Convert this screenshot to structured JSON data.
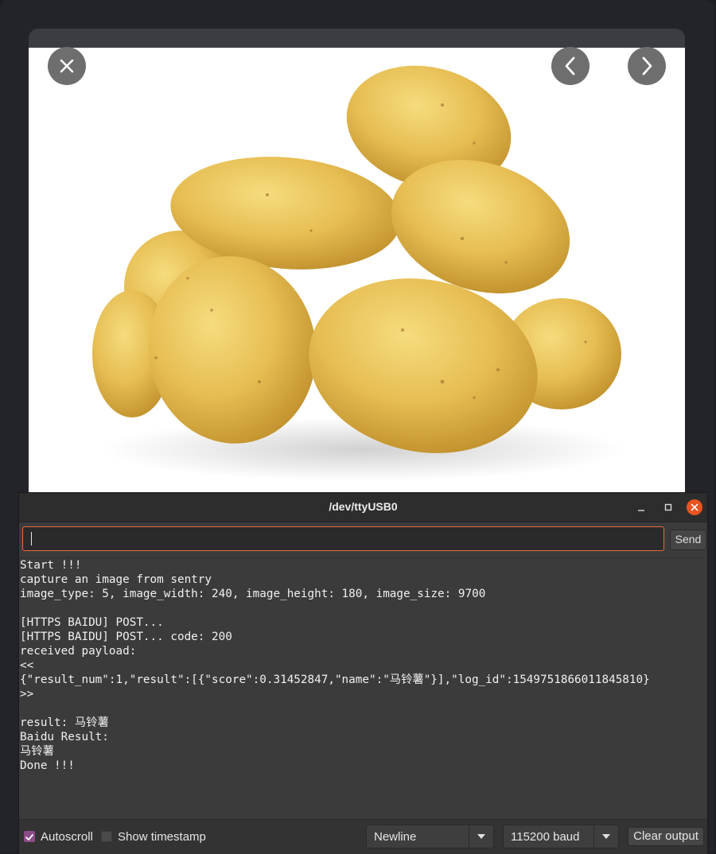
{
  "viewer": {
    "image_subject": "potatoes",
    "buttons": {
      "close": "close-icon",
      "previous": "chevron-left-icon",
      "next": "chevron-right-icon"
    }
  },
  "serial_monitor": {
    "title": "/dev/ttyUSB0",
    "send_input": {
      "value": "",
      "placeholder": ""
    },
    "send_label": "Send",
    "output_lines": [
      "Start !!!",
      "capture an image from sentry",
      "image_type: 5, image_width: 240, image_height: 180, image_size: 9700",
      "",
      "[HTTPS BAIDU] POST...",
      "[HTTPS BAIDU] POST... code: 200",
      "received payload:",
      "<<",
      "{\"result_num\":1,\"result\":[{\"score\":0.31452847,\"name\":\"马铃薯\"}],\"log_id\":1549751866011845810}",
      ">>",
      "",
      "result: 马铃薯",
      "Baidu Result:",
      "马铃薯",
      "Done !!!"
    ],
    "footer": {
      "autoscroll_label": "Autoscroll",
      "autoscroll_checked": true,
      "timestamp_label": "Show timestamp",
      "timestamp_checked": false,
      "line_ending": "Newline",
      "baud": "115200 baud",
      "clear_label": "Clear output"
    },
    "colors": {
      "accent": "#e95420",
      "checkbox": "#8d4b87",
      "input_border": "#e86b3a"
    }
  }
}
